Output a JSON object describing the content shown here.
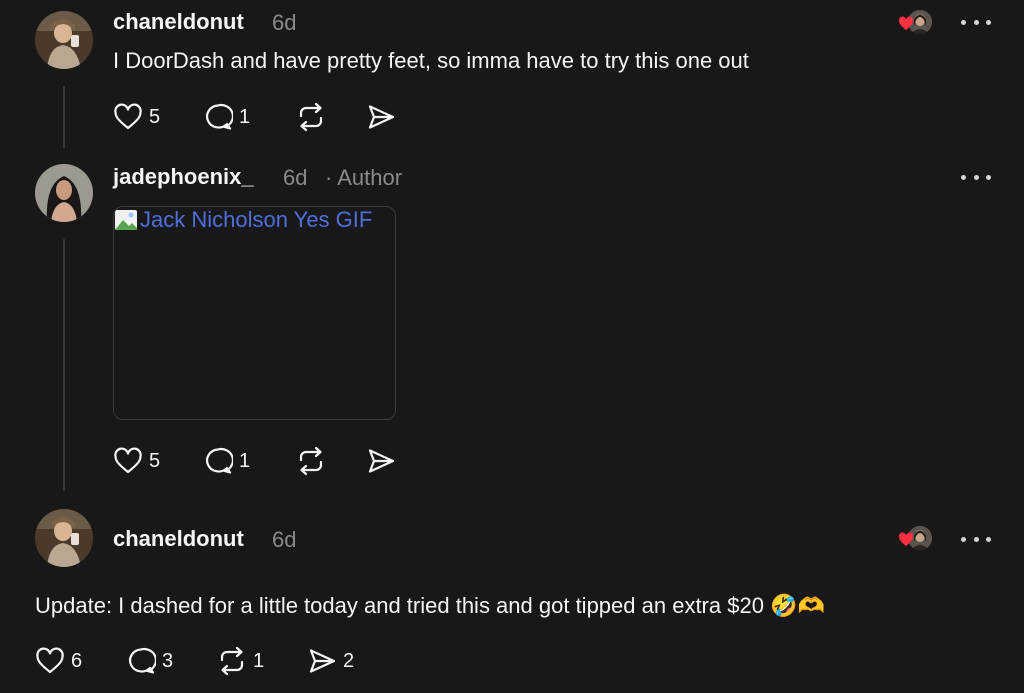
{
  "comments": [
    {
      "username": "chaneldonut",
      "time": "6d",
      "text": "I DoorDash and have pretty feet, so imma have to try this one out",
      "actions": {
        "likes": "5",
        "replies": "1"
      }
    },
    {
      "username": "jadephoenix_",
      "time": "6d",
      "author_tag": "· Author",
      "gif_alt": "Jack Nicholson Yes GIF",
      "actions": {
        "likes": "5",
        "replies": "1"
      }
    },
    {
      "username": "chaneldonut",
      "time": "6d",
      "text": "Update: I dashed for a little today and tried this and got tipped an extra $20 🤣🫶",
      "actions": {
        "likes": "6",
        "replies": "3",
        "reposts": "1",
        "shares": "2"
      }
    }
  ],
  "icons": {
    "like": "heart-outline-icon",
    "reply": "speech-bubble-icon",
    "repost": "repost-arrows-icon",
    "share": "paper-plane-icon",
    "more": "more-dots-icon",
    "liked_by": "liked-by-author-badge"
  },
  "colors": {
    "background": "#181818",
    "text": "#f3f5f7",
    "muted": "#8a8a8a",
    "link": "#4e6fd8",
    "heart": "#ff3040"
  }
}
